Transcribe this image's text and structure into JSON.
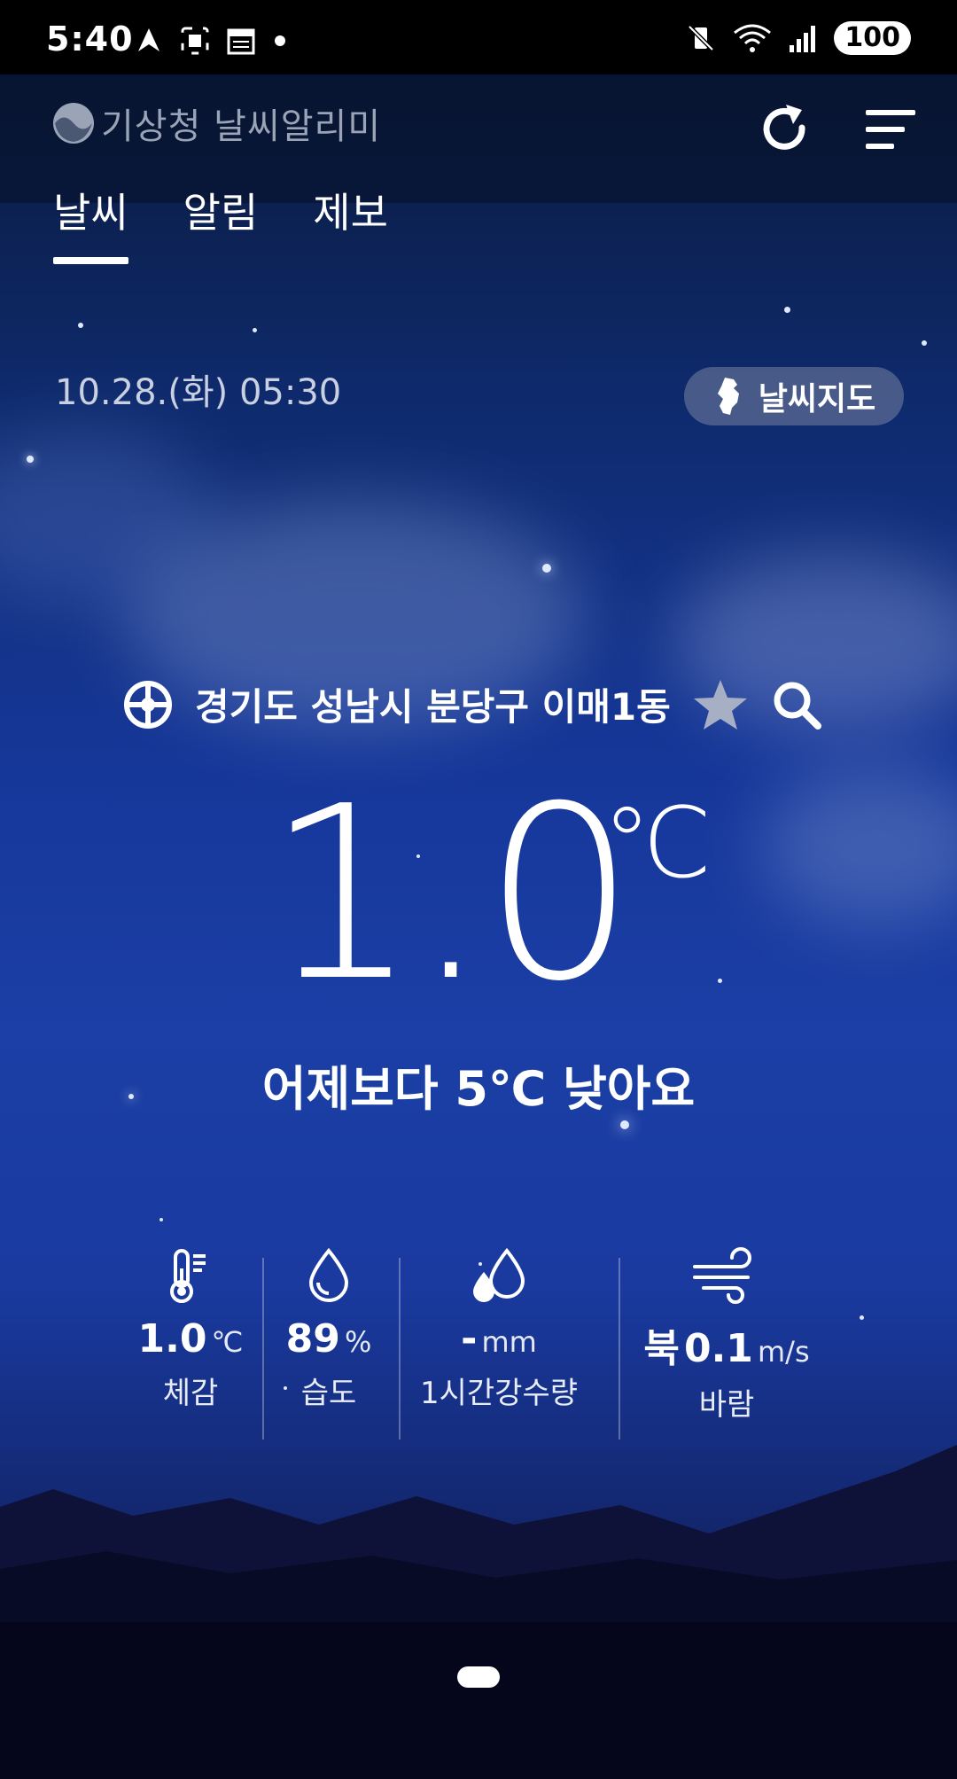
{
  "status_bar": {
    "time": "5:40",
    "battery": "100"
  },
  "header": {
    "app_title": "기상청 날씨알리미"
  },
  "tabs": [
    {
      "label": "날씨",
      "active": true
    },
    {
      "label": "알림",
      "active": false
    },
    {
      "label": "제보",
      "active": false
    }
  ],
  "weather": {
    "datetime": "10.28.(화) 05:30",
    "map_button": "날씨지도",
    "location": "경기도 성남시 분당구 이매1동",
    "temperature": "1.0",
    "temperature_unit": "℃",
    "comparison": "어제보다 5℃ 낮아요"
  },
  "metrics": [
    {
      "icon": "thermometer-icon",
      "value": "1.0",
      "unit": "℃",
      "label": "체감"
    },
    {
      "icon": "humidity-drop-icon",
      "value": "89",
      "unit": "%",
      "label": "습도"
    },
    {
      "icon": "rain-drops-icon",
      "value": "-",
      "unit": "mm",
      "label": "1시간강수량"
    },
    {
      "icon": "wind-icon",
      "direction": "북",
      "value": "0.1",
      "unit": "m/s",
      "label": "바람"
    }
  ],
  "colors": {
    "sky_top": "#0b1a3c",
    "sky_mid": "#16379a",
    "accent": "#ffffff",
    "muted": "#9aa4b6"
  }
}
